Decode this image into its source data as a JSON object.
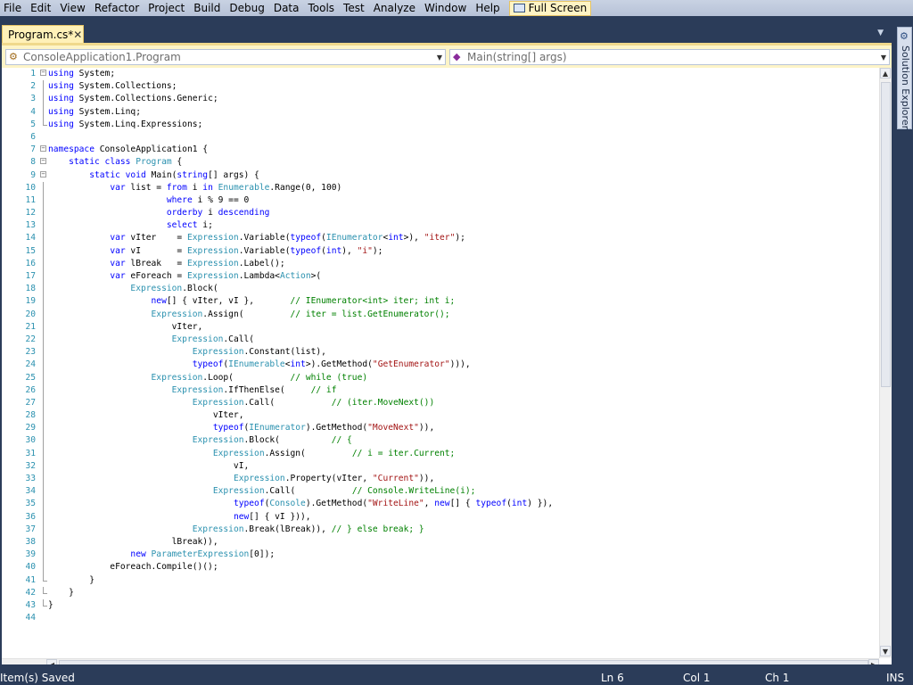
{
  "menu": [
    "File",
    "Edit",
    "View",
    "Refactor",
    "Project",
    "Build",
    "Debug",
    "Data",
    "Tools",
    "Test",
    "Analyze",
    "Window",
    "Help"
  ],
  "fullscreen_label": "Full Screen",
  "tab": {
    "title": "Program.cs*",
    "close": "✕"
  },
  "tab_dropdown": "▼",
  "nav": {
    "type_combo": "ConsoleApplication1.Program",
    "member_combo": "Main(string[] args)"
  },
  "side_panel": {
    "label": "Solution Explorer"
  },
  "status": {
    "message": "Item(s) Saved",
    "ln": "Ln 6",
    "col": "Col 1",
    "ch": "Ch 1",
    "mode": "INS"
  },
  "code_lines": [
    [
      [
        "k",
        "using"
      ],
      [
        "p",
        " System;"
      ]
    ],
    [
      [
        "k",
        "using"
      ],
      [
        "p",
        " System.Collections;"
      ]
    ],
    [
      [
        "k",
        "using"
      ],
      [
        "p",
        " System.Collections.Generic;"
      ]
    ],
    [
      [
        "k",
        "using"
      ],
      [
        "p",
        " System.Linq;"
      ]
    ],
    [
      [
        "k",
        "using"
      ],
      [
        "p",
        " System.Linq.Expressions;"
      ]
    ],
    [],
    [
      [
        "k",
        "namespace"
      ],
      [
        "p",
        " ConsoleApplication1 {"
      ]
    ],
    [
      [
        "p",
        "    "
      ],
      [
        "k",
        "static"
      ],
      [
        "p",
        " "
      ],
      [
        "k",
        "class"
      ],
      [
        "p",
        " "
      ],
      [
        "t",
        "Program"
      ],
      [
        "p",
        " {"
      ]
    ],
    [
      [
        "p",
        "        "
      ],
      [
        "k",
        "static"
      ],
      [
        "p",
        " "
      ],
      [
        "k",
        "void"
      ],
      [
        "p",
        " Main("
      ],
      [
        "k",
        "string"
      ],
      [
        "p",
        "[] args) {"
      ]
    ],
    [
      [
        "p",
        "            "
      ],
      [
        "k",
        "var"
      ],
      [
        "p",
        " list = "
      ],
      [
        "k",
        "from"
      ],
      [
        "p",
        " i "
      ],
      [
        "k",
        "in"
      ],
      [
        "p",
        " "
      ],
      [
        "t",
        "Enumerable"
      ],
      [
        "p",
        ".Range(0, 100)"
      ]
    ],
    [
      [
        "p",
        "                       "
      ],
      [
        "k",
        "where"
      ],
      [
        "p",
        " i % 9 == 0"
      ]
    ],
    [
      [
        "p",
        "                       "
      ],
      [
        "k",
        "orderby"
      ],
      [
        "p",
        " i "
      ],
      [
        "k",
        "descending"
      ]
    ],
    [
      [
        "p",
        "                       "
      ],
      [
        "k",
        "select"
      ],
      [
        "p",
        " i;"
      ]
    ],
    [
      [
        "p",
        "            "
      ],
      [
        "k",
        "var"
      ],
      [
        "p",
        " vIter    = "
      ],
      [
        "t",
        "Expression"
      ],
      [
        "p",
        ".Variable("
      ],
      [
        "k",
        "typeof"
      ],
      [
        "p",
        "("
      ],
      [
        "t",
        "IEnumerator"
      ],
      [
        "p",
        "<"
      ],
      [
        "k",
        "int"
      ],
      [
        "p",
        ">), "
      ],
      [
        "s",
        "\"iter\""
      ],
      [
        "p",
        ");"
      ]
    ],
    [
      [
        "p",
        "            "
      ],
      [
        "k",
        "var"
      ],
      [
        "p",
        " vI       = "
      ],
      [
        "t",
        "Expression"
      ],
      [
        "p",
        ".Variable("
      ],
      [
        "k",
        "typeof"
      ],
      [
        "p",
        "("
      ],
      [
        "k",
        "int"
      ],
      [
        "p",
        "), "
      ],
      [
        "s",
        "\"i\""
      ],
      [
        "p",
        ");"
      ]
    ],
    [
      [
        "p",
        "            "
      ],
      [
        "k",
        "var"
      ],
      [
        "p",
        " lBreak   = "
      ],
      [
        "t",
        "Expression"
      ],
      [
        "p",
        ".Label();"
      ]
    ],
    [
      [
        "p",
        "            "
      ],
      [
        "k",
        "var"
      ],
      [
        "p",
        " eForeach = "
      ],
      [
        "t",
        "Expression"
      ],
      [
        "p",
        ".Lambda<"
      ],
      [
        "t",
        "Action"
      ],
      [
        "p",
        ">("
      ]
    ],
    [
      [
        "p",
        "                "
      ],
      [
        "t",
        "Expression"
      ],
      [
        "p",
        ".Block("
      ]
    ],
    [
      [
        "p",
        "                    "
      ],
      [
        "k",
        "new"
      ],
      [
        "p",
        "[] { vIter, vI },       "
      ],
      [
        "c",
        "// IEnumerator<int> iter; int i;"
      ]
    ],
    [
      [
        "p",
        "                    "
      ],
      [
        "t",
        "Expression"
      ],
      [
        "p",
        ".Assign(         "
      ],
      [
        "c",
        "// iter = list.GetEnumerator();"
      ]
    ],
    [
      [
        "p",
        "                        vIter,"
      ]
    ],
    [
      [
        "p",
        "                        "
      ],
      [
        "t",
        "Expression"
      ],
      [
        "p",
        ".Call("
      ]
    ],
    [
      [
        "p",
        "                            "
      ],
      [
        "t",
        "Expression"
      ],
      [
        "p",
        ".Constant(list),"
      ]
    ],
    [
      [
        "p",
        "                            "
      ],
      [
        "k",
        "typeof"
      ],
      [
        "p",
        "("
      ],
      [
        "t",
        "IEnumerable"
      ],
      [
        "p",
        "<"
      ],
      [
        "k",
        "int"
      ],
      [
        "p",
        ">).GetMethod("
      ],
      [
        "s",
        "\"GetEnumerator\""
      ],
      [
        "p",
        "))),"
      ]
    ],
    [
      [
        "p",
        "                    "
      ],
      [
        "t",
        "Expression"
      ],
      [
        "p",
        ".Loop(           "
      ],
      [
        "c",
        "// while (true)"
      ]
    ],
    [
      [
        "p",
        "                        "
      ],
      [
        "t",
        "Expression"
      ],
      [
        "p",
        ".IfThenElse(     "
      ],
      [
        "c",
        "// if"
      ]
    ],
    [
      [
        "p",
        "                            "
      ],
      [
        "t",
        "Expression"
      ],
      [
        "p",
        ".Call(           "
      ],
      [
        "c",
        "// (iter.MoveNext())"
      ]
    ],
    [
      [
        "p",
        "                                vIter,"
      ]
    ],
    [
      [
        "p",
        "                                "
      ],
      [
        "k",
        "typeof"
      ],
      [
        "p",
        "("
      ],
      [
        "t",
        "IEnumerator"
      ],
      [
        "p",
        ").GetMethod("
      ],
      [
        "s",
        "\"MoveNext\""
      ],
      [
        "p",
        ")),"
      ]
    ],
    [
      [
        "p",
        "                            "
      ],
      [
        "t",
        "Expression"
      ],
      [
        "p",
        ".Block(          "
      ],
      [
        "c",
        "// {"
      ]
    ],
    [
      [
        "p",
        "                                "
      ],
      [
        "t",
        "Expression"
      ],
      [
        "p",
        ".Assign(         "
      ],
      [
        "c",
        "// i = iter.Current;"
      ]
    ],
    [
      [
        "p",
        "                                    vI,"
      ]
    ],
    [
      [
        "p",
        "                                    "
      ],
      [
        "t",
        "Expression"
      ],
      [
        "p",
        ".Property(vIter, "
      ],
      [
        "s",
        "\"Current\""
      ],
      [
        "p",
        ")),"
      ]
    ],
    [
      [
        "p",
        "                                "
      ],
      [
        "t",
        "Expression"
      ],
      [
        "p",
        ".Call(           "
      ],
      [
        "c",
        "// Console.WriteLine(i);"
      ]
    ],
    [
      [
        "p",
        "                                    "
      ],
      [
        "k",
        "typeof"
      ],
      [
        "p",
        "("
      ],
      [
        "t",
        "Console"
      ],
      [
        "p",
        ").GetMethod("
      ],
      [
        "s",
        "\"WriteLine\""
      ],
      [
        "p",
        ", "
      ],
      [
        "k",
        "new"
      ],
      [
        "p",
        "[] { "
      ],
      [
        "k",
        "typeof"
      ],
      [
        "p",
        "("
      ],
      [
        "k",
        "int"
      ],
      [
        "p",
        ") }),"
      ]
    ],
    [
      [
        "p",
        "                                    "
      ],
      [
        "k",
        "new"
      ],
      [
        "p",
        "[] { vI })),"
      ]
    ],
    [
      [
        "p",
        "                            "
      ],
      [
        "t",
        "Expression"
      ],
      [
        "p",
        ".Break(lBreak)), "
      ],
      [
        "c",
        "// } else break; }"
      ]
    ],
    [
      [
        "p",
        "                        lBreak)),"
      ]
    ],
    [
      [
        "p",
        "                "
      ],
      [
        "k",
        "new"
      ],
      [
        "p",
        " "
      ],
      [
        "t",
        "ParameterExpression"
      ],
      [
        "p",
        "[0]);"
      ]
    ],
    [
      [
        "p",
        "            eForeach.Compile()();"
      ]
    ],
    [
      [
        "p",
        "        }"
      ]
    ],
    [
      [
        "p",
        "    }"
      ]
    ],
    [
      [
        "p",
        "}"
      ]
    ],
    []
  ]
}
